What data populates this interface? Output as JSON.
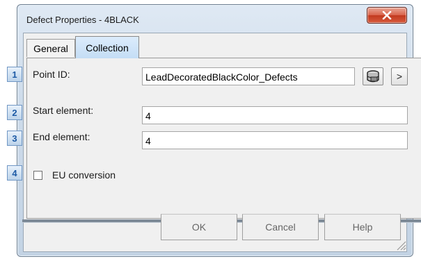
{
  "window": {
    "title": "Defect Properties - 4BLACK"
  },
  "tabs": [
    {
      "label": "General",
      "active": false
    },
    {
      "label": "Collection",
      "active": true
    }
  ],
  "fields": {
    "point_id": {
      "badge": "1",
      "label": "Point ID:",
      "value": "LeadDecoratedBlackColor_Defects"
    },
    "start_element": {
      "badge": "2",
      "label": "Start element:",
      "value": "4"
    },
    "end_element": {
      "badge": "3",
      "label": "End element:",
      "value": "4"
    },
    "eu_conversion": {
      "badge": "4",
      "label": "EU conversion",
      "checked": false
    }
  },
  "point_id_buttons": {
    "browse_icon": "database-browse-icon",
    "next_label": ">"
  },
  "buttons": {
    "ok": "OK",
    "cancel": "Cancel",
    "help": "Help"
  },
  "colors": {
    "close_button": "#d9634a",
    "badge_text": "#1d5aa5",
    "active_tab": "#c4ddf5"
  }
}
